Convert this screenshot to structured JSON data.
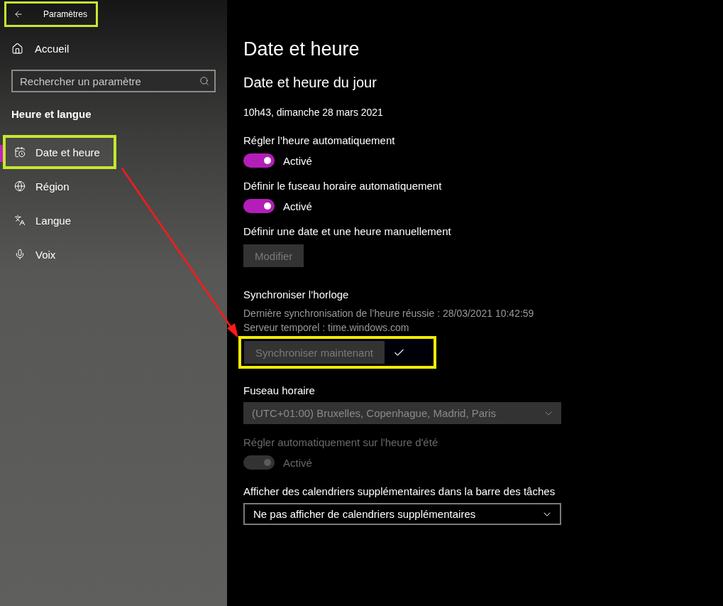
{
  "header": {
    "title": "Paramètres",
    "annotation": {
      "color": "#c5e82e"
    }
  },
  "sidebar": {
    "home": "Accueil",
    "search": {
      "placeholder": "Rechercher un paramètre"
    },
    "section": "Heure et langue",
    "items": [
      {
        "label": "Date et heure",
        "selected": true,
        "annotation": {
          "color": "#c5e82e"
        }
      },
      {
        "label": "Région",
        "selected": false
      },
      {
        "label": "Langue",
        "selected": false
      },
      {
        "label": "Voix",
        "selected": false
      }
    ]
  },
  "main": {
    "title": "Date et heure",
    "subtitle": "Date et heure du jour",
    "now": "10h43, dimanche 28 mars 2021",
    "settings": [
      {
        "kind": "toggle",
        "label": "Régler l’heure automatiquement",
        "on": true,
        "disabled": false,
        "state_text": "Activé"
      },
      {
        "kind": "toggle",
        "label": "Définir le fuseau horaire automatiquement",
        "on": true,
        "disabled": false,
        "state_text": "Activé"
      },
      {
        "kind": "button",
        "label": "Définir une date et une heure manuellement",
        "button": "Modifier",
        "disabled": true
      },
      {
        "kind": "sync",
        "label": "Synchroniser l’horloge",
        "lines": [
          "Dernière synchronisation de l’heure réussie : 28/03/2021 10:42:59",
          "Serveur temporel : time.windows.com"
        ],
        "button": "Synchroniser maintenant",
        "disabled": true,
        "done": true,
        "annotation": {
          "color": "#f2ea00"
        }
      },
      {
        "kind": "select",
        "label": "Fuseau horaire",
        "value": "(UTC+01:00) Bruxelles, Copenhague, Madrid, Paris",
        "disabled": true
      },
      {
        "kind": "toggle",
        "label": "Régler automatiquement sur l'heure d'été",
        "on": true,
        "disabled": true,
        "state_text": "Activé"
      },
      {
        "kind": "select",
        "label": "Afficher des calendriers supplémentaires dans la barre des tâches",
        "value": "Ne pas afficher de calendriers supplémentaires",
        "disabled": false
      }
    ]
  },
  "arrow": {
    "color": "#ff1a1a"
  }
}
